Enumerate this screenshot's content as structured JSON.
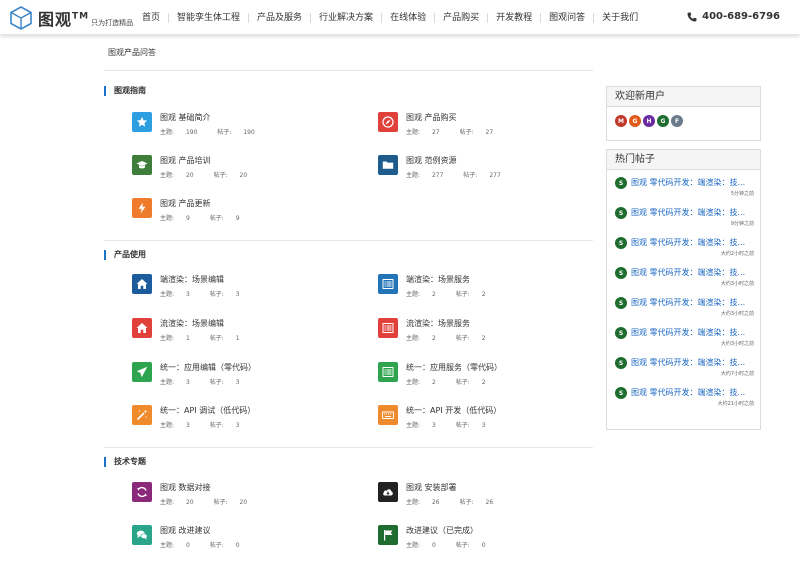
{
  "header": {
    "logo_text": "图观",
    "logo_tm": "TM",
    "logo_slogan": "只为打造精品",
    "nav": [
      "首页",
      "智能孪生体工程",
      "产品及服务",
      "行业解决方案",
      "在线体验",
      "产品购买",
      "开发教程",
      "图观问答",
      "关于我们"
    ],
    "phone": "400-689-6796"
  },
  "breadcrumb": "图观产品问答",
  "sections": [
    {
      "title": "图观指南",
      "forums": [
        {
          "title": "图观 基础简介",
          "topics_label": "主题:",
          "topics": "190",
          "posts_label": "帖子:",
          "posts": "190",
          "icon": "star-icon",
          "color": "#2d9ee0"
        },
        {
          "title": "图观 产品购买",
          "topics_label": "主题:",
          "topics": "27",
          "posts_label": "帖子:",
          "posts": "27",
          "icon": "compass-icon",
          "color": "#e0413a"
        },
        {
          "title": "图观 产品培训",
          "topics_label": "主题:",
          "topics": "20",
          "posts_label": "帖子:",
          "posts": "20",
          "icon": "graduation-cap-icon",
          "color": "#3f7d3a"
        },
        {
          "title": "图观 范例资源",
          "topics_label": "主题:",
          "topics": "277",
          "posts_label": "帖子:",
          "posts": "277",
          "icon": "folder-icon",
          "color": "#1d5c8c"
        },
        {
          "title": "图观 产品更新",
          "topics_label": "主题:",
          "topics": "9",
          "posts_label": "帖子:",
          "posts": "9",
          "icon": "bolt-icon",
          "color": "#ef7b2c"
        }
      ]
    },
    {
      "title": "产品使用",
      "forums": [
        {
          "title": "端渲染：场景编辑",
          "topics_label": "主题:",
          "topics": "3",
          "posts_label": "帖子:",
          "posts": "3",
          "icon": "home-icon",
          "color": "#1d5c9c"
        },
        {
          "title": "端渲染：场景服务",
          "topics_label": "主题:",
          "topics": "2",
          "posts_label": "帖子:",
          "posts": "2",
          "icon": "list-icon",
          "color": "#2273b8"
        },
        {
          "title": "流渲染：场景编辑",
          "topics_label": "主题:",
          "topics": "1",
          "posts_label": "帖子:",
          "posts": "1",
          "icon": "home-icon",
          "color": "#e0413a"
        },
        {
          "title": "流渲染：场景服务",
          "topics_label": "主题:",
          "topics": "2",
          "posts_label": "帖子:",
          "posts": "2",
          "icon": "list-icon",
          "color": "#e0413a"
        },
        {
          "title": "统一：应用编辑（零代码）",
          "topics_label": "主题:",
          "topics": "3",
          "posts_label": "帖子:",
          "posts": "3",
          "icon": "send-icon",
          "color": "#2ea44f"
        },
        {
          "title": "统一：应用服务（零代码）",
          "topics_label": "主题:",
          "topics": "2",
          "posts_label": "帖子:",
          "posts": "2",
          "icon": "list-icon",
          "color": "#2ea44f"
        },
        {
          "title": "统一：API 调试（低代码）",
          "topics_label": "主题:",
          "topics": "3",
          "posts_label": "帖子:",
          "posts": "3",
          "icon": "magic-wand-icon",
          "color": "#ef8b2c"
        },
        {
          "title": "统一：API 开发（低代码）",
          "topics_label": "主题:",
          "topics": "3",
          "posts_label": "帖子:",
          "posts": "3",
          "icon": "keyboard-icon",
          "color": "#ef8b2c"
        }
      ]
    },
    {
      "title": "技术专题",
      "forums": [
        {
          "title": "图观 数据对接",
          "topics_label": "主题:",
          "topics": "20",
          "posts_label": "帖子:",
          "posts": "20",
          "icon": "refresh-icon",
          "color": "#8b2a7a"
        },
        {
          "title": "图观 安装部署",
          "topics_label": "主题:",
          "topics": "26",
          "posts_label": "帖子:",
          "posts": "26",
          "icon": "cloud-download-icon",
          "color": "#222222"
        },
        {
          "title": "图观 改进建议",
          "topics_label": "主题:",
          "topics": "0",
          "posts_label": "帖子:",
          "posts": "0",
          "icon": "chat-icon",
          "color": "#2aa58a"
        },
        {
          "title": "改进建议（已完成）",
          "topics_label": "主题:",
          "topics": "0",
          "posts_label": "帖子:",
          "posts": "0",
          "icon": "flag-icon",
          "color": "#1e6d2f"
        }
      ]
    }
  ],
  "sidebar": {
    "new_users_title": "欢迎新用户",
    "new_users": [
      {
        "letter": "M",
        "color": "#c0392b"
      },
      {
        "letter": "G",
        "color": "#e05a1c"
      },
      {
        "letter": "H",
        "color": "#6a2aa0"
      },
      {
        "letter": "G",
        "color": "#1e6d2f"
      },
      {
        "letter": "F",
        "color": "#6a7a8a"
      }
    ],
    "hot_title": "热门帖子",
    "hot_posts": [
      {
        "badge": "S",
        "title": "图观 零代码开发：端渲染：技...",
        "time": "5分钟之前"
      },
      {
        "badge": "S",
        "title": "图观 零代码开发：端渲染：技...",
        "time": "9分钟之前"
      },
      {
        "badge": "S",
        "title": "图观 零代码开发：端渲染：技...",
        "time": "大约2小时之前"
      },
      {
        "badge": "S",
        "title": "图观 零代码开发：端渲染：技...",
        "time": "大约3小时之前"
      },
      {
        "badge": "S",
        "title": "图观 零代码开发：端渲染：技...",
        "time": "大约3小时之前"
      },
      {
        "badge": "S",
        "title": "图观 零代码开发：端渲染：技...",
        "time": "大约3小时之前"
      },
      {
        "badge": "S",
        "title": "图观 零代码开发：端渲染：技...",
        "time": "大约7小时之前"
      },
      {
        "badge": "S",
        "title": "图观 零代码开发：端渲染：技...",
        "time": "大约21小时之前"
      }
    ]
  }
}
